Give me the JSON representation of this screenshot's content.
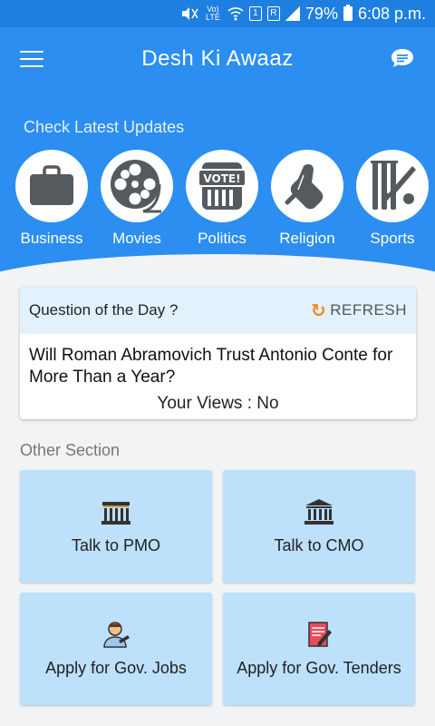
{
  "status_bar": {
    "volte": "Vo) LTE",
    "sim": "1",
    "sim2": "R",
    "battery": "79%",
    "time": "6:08 p.m."
  },
  "app_bar": {
    "title": "Desh Ki Awaaz",
    "menu_icon": "hamburger-menu-icon",
    "chat_icon": "chat-bubble-icon"
  },
  "updates": {
    "heading": "Check Latest Updates",
    "categories": [
      {
        "label": "Business",
        "icon": "briefcase-icon"
      },
      {
        "label": "Movies",
        "icon": "film-reel-icon"
      },
      {
        "label": "Politics",
        "icon": "vote-box-icon"
      },
      {
        "label": "Religion",
        "icon": "praying-hands-icon"
      },
      {
        "label": "Sports",
        "icon": "cricket-icon"
      }
    ]
  },
  "question_card": {
    "heading": "Question of the Day ?",
    "refresh_label": "REFRESH",
    "question": "Will Roman Abramovich Trust Antonio Conte for More Than a Year?",
    "views": "Your Views : No"
  },
  "other_section": {
    "heading": "Other Section",
    "tiles": [
      {
        "label": "Talk to PMO",
        "icon": "government-building-icon"
      },
      {
        "label": "Talk to CMO",
        "icon": "parliament-building-icon"
      },
      {
        "label": "Apply for Gov. Jobs",
        "icon": "job-applicant-icon"
      },
      {
        "label": "Apply for Gov. Tenders",
        "icon": "tender-document-icon"
      }
    ]
  },
  "colors": {
    "primary": "#2b8ef0",
    "status_bar": "#1e7fe0",
    "tile_bg": "#bde0fb",
    "question_header_bg": "#e2f1fc",
    "refresh_accent": "#f08a1a"
  }
}
